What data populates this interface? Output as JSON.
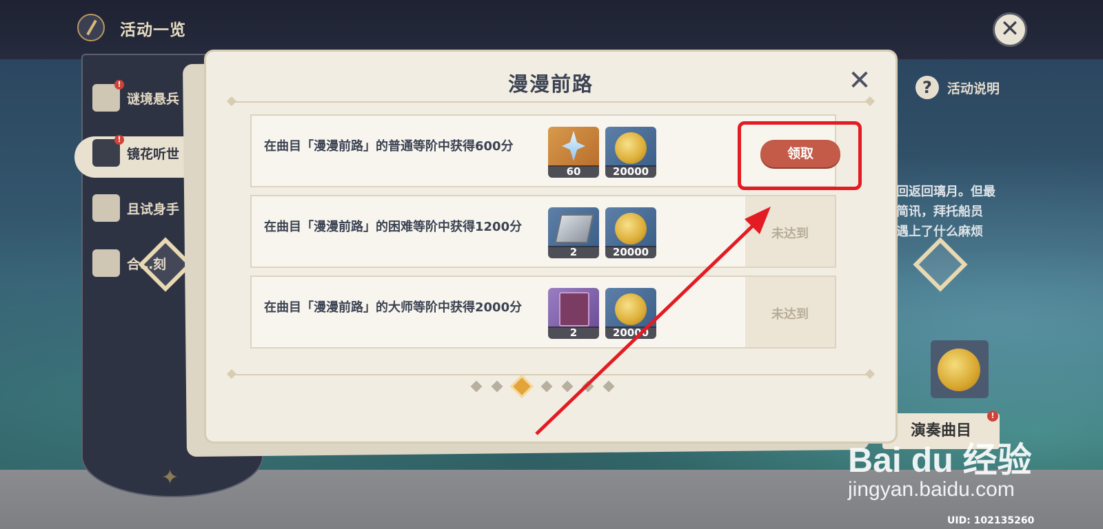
{
  "header": {
    "title": "活动一览"
  },
  "sidebar": {
    "items": [
      {
        "label": "谜境悬兵",
        "badge": "!"
      },
      {
        "label": "镜花听世",
        "badge": "!"
      },
      {
        "label": "且试身手"
      },
      {
        "label": "合…刻"
      }
    ]
  },
  "right_panel": {
    "help_label": "活动说明",
    "help_icon": "?",
    "story_lines": [
      "回返回璃月。但最",
      "简讯，拜托船员",
      "遇上了什么麻烦"
    ],
    "perform_label": "演奏曲目",
    "perform_badge": "!"
  },
  "dialog": {
    "title": "漫漫前路",
    "close_icon": "✕",
    "rows": [
      {
        "requirement": "在曲目「漫漫前路」的普通等阶中获得600分",
        "rewards": [
          {
            "icon": "primogem",
            "count": "60"
          },
          {
            "icon": "mora-coin",
            "count": "20000"
          }
        ],
        "status": "领取",
        "claimable": true
      },
      {
        "requirement": "在曲目「漫漫前路」的困难等阶中获得1200分",
        "rewards": [
          {
            "icon": "enhancement-ore",
            "count": "2"
          },
          {
            "icon": "mora-coin",
            "count": "20000"
          }
        ],
        "status": "未达到",
        "claimable": false
      },
      {
        "requirement": "在曲目「漫漫前路」的大师等阶中获得2000分",
        "rewards": [
          {
            "icon": "heros-wit-book",
            "count": "2"
          },
          {
            "icon": "mora-coin",
            "count": "20000"
          }
        ],
        "status": "未达到",
        "claimable": false
      }
    ],
    "pager": {
      "total": 7,
      "active_index": 2
    }
  },
  "colors": {
    "claim_button": "#c45b48",
    "highlight_annotation": "#e31b23",
    "active_page_dot": "#e3a43b"
  },
  "watermark": {
    "logo": "Bai du 经验",
    "url": "jingyan.baidu.com"
  },
  "uid": "UID: 102135260",
  "top_close_icon": "✕"
}
